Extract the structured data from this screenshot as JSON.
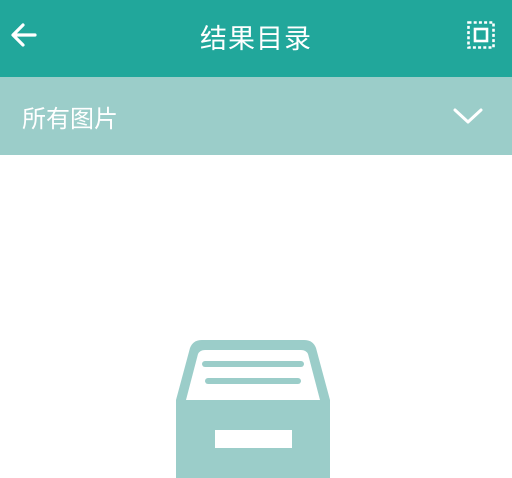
{
  "header": {
    "title": "结果目录",
    "back_icon": "arrow-left-icon",
    "select_icon": "select-all-icon",
    "background_color": "#21a79b"
  },
  "filter": {
    "selected_label": "所有图片",
    "dropdown_icon": "chevron-down-icon",
    "background_color": "#9bcdc9"
  },
  "empty_state": {
    "icon": "empty-archive-box-icon",
    "icon_color": "#9bcdc9"
  }
}
